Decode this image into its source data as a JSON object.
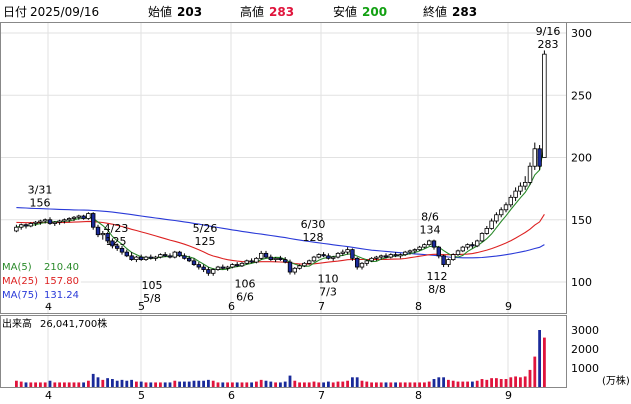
{
  "header": {
    "date_label": "日付",
    "date": "2025/09/16",
    "open_label": "始値",
    "open": "203",
    "high_label": "高値",
    "high": "283",
    "low_label": "安値",
    "low": "200",
    "close_label": "終値",
    "close": "283"
  },
  "legend": [
    {
      "name": "MA(5)",
      "value": "210.40",
      "color": "#2a8a2a"
    },
    {
      "name": "MA(25)",
      "value": "157.80",
      "color": "#d22"
    },
    {
      "name": "MA(75)",
      "value": "131.24",
      "color": "#2a3ad8"
    }
  ],
  "volume": {
    "title": "出来高",
    "total": "26,041,700株",
    "unit": "(万株)",
    "ticks": [
      "3000",
      "2000",
      "1000"
    ]
  },
  "chart_data": [
    {
      "type": "candlestick",
      "title": "",
      "y_ticks": [
        300,
        250,
        200,
        150,
        100
      ],
      "ylim": [
        90,
        310
      ],
      "x_ticks": [
        "4",
        "5",
        "6",
        "7",
        "8",
        "9"
      ],
      "annotations": [
        {
          "date": "3/31",
          "value": "156",
          "position": "above"
        },
        {
          "date": "4/23",
          "value": "125",
          "position": "above"
        },
        {
          "date": "5/26",
          "value": "125",
          "position": "above"
        },
        {
          "date": "6/30",
          "value": "128",
          "position": "above"
        },
        {
          "date": "8/6",
          "value": "134",
          "position": "above"
        },
        {
          "date": "9/16",
          "value": "283",
          "position": "above"
        },
        {
          "date": "5/8",
          "value": "105",
          "position": "below"
        },
        {
          "date": "6/6",
          "value": "106",
          "position": "below"
        },
        {
          "date": "7/3",
          "value": "110",
          "position": "below"
        },
        {
          "date": "8/8",
          "value": "112",
          "position": "below"
        }
      ],
      "candles_trend": [
        [
          3,
          141,
          146,
          140,
          144
        ],
        [
          4,
          144,
          147,
          142,
          146
        ],
        [
          5,
          146,
          147,
          143,
          145
        ],
        [
          6,
          145,
          148,
          144,
          147
        ],
        [
          7,
          147,
          149,
          145,
          148
        ],
        [
          8,
          148,
          150,
          146,
          149
        ],
        [
          9,
          149,
          151,
          147,
          150
        ],
        [
          10,
          150,
          152,
          146,
          147
        ],
        [
          11,
          147,
          149,
          145,
          148
        ],
        [
          12,
          148,
          150,
          146,
          149
        ],
        [
          13,
          149,
          151,
          147,
          150
        ],
        [
          14,
          150,
          152,
          148,
          151
        ],
        [
          15,
          151,
          153,
          149,
          152
        ],
        [
          16,
          152,
          154,
          150,
          153
        ],
        [
          17,
          153,
          154,
          150,
          151
        ],
        [
          18,
          151,
          156,
          150,
          155
        ],
        [
          19,
          155,
          156,
          142,
          144
        ],
        [
          20,
          144,
          146,
          136,
          138
        ],
        [
          21,
          138,
          141,
          134,
          139
        ],
        [
          22,
          139,
          140,
          131,
          133
        ],
        [
          23,
          133,
          135,
          127,
          129
        ],
        [
          24,
          129,
          131,
          125,
          127
        ],
        [
          25,
          127,
          129,
          122,
          124
        ],
        [
          26,
          124,
          126,
          120,
          121
        ],
        [
          27,
          121,
          124,
          117,
          118
        ],
        [
          28,
          118,
          121,
          116,
          120
        ],
        [
          29,
          120,
          122,
          117,
          118
        ],
        [
          30,
          118,
          121,
          117,
          120
        ],
        [
          31,
          120,
          122,
          118,
          119
        ],
        [
          32,
          119,
          121,
          117,
          120
        ],
        [
          33,
          120,
          123,
          119,
          122
        ],
        [
          34,
          122,
          124,
          120,
          121
        ],
        [
          35,
          121,
          123,
          119,
          120
        ],
        [
          36,
          120,
          125,
          119,
          124
        ],
        [
          37,
          124,
          125,
          120,
          121
        ],
        [
          38,
          121,
          123,
          118,
          119
        ],
        [
          39,
          119,
          121,
          116,
          117
        ],
        [
          40,
          117,
          119,
          113,
          114
        ],
        [
          41,
          114,
          116,
          110,
          112
        ],
        [
          42,
          112,
          114,
          108,
          110
        ],
        [
          43,
          110,
          112,
          105,
          107
        ],
        [
          44,
          107,
          111,
          105,
          110
        ],
        [
          45,
          110,
          113,
          109,
          112
        ],
        [
          46,
          112,
          114,
          110,
          111
        ],
        [
          47,
          111,
          113,
          109,
          112
        ],
        [
          48,
          112,
          115,
          111,
          114
        ],
        [
          49,
          114,
          116,
          112,
          113
        ],
        [
          50,
          113,
          116,
          112,
          115
        ],
        [
          51,
          115,
          118,
          114,
          117
        ],
        [
          52,
          117,
          119,
          115,
          116
        ],
        [
          53,
          116,
          120,
          115,
          119
        ],
        [
          54,
          119,
          125,
          118,
          123
        ],
        [
          55,
          123,
          125,
          119,
          120
        ],
        [
          56,
          120,
          122,
          117,
          118
        ],
        [
          57,
          118,
          120,
          116,
          119
        ],
        [
          58,
          119,
          121,
          117,
          118
        ],
        [
          59,
          118,
          120,
          115,
          116
        ],
        [
          60,
          116,
          118,
          106,
          108
        ],
        [
          61,
          108,
          112,
          106,
          111
        ],
        [
          62,
          111,
          114,
          110,
          113
        ],
        [
          63,
          113,
          116,
          112,
          115
        ],
        [
          64,
          115,
          118,
          114,
          117
        ],
        [
          65,
          117,
          121,
          116,
          120
        ],
        [
          66,
          120,
          123,
          119,
          122
        ],
        [
          67,
          122,
          124,
          120,
          121
        ],
        [
          68,
          121,
          123,
          118,
          119
        ],
        [
          69,
          119,
          121,
          117,
          120
        ],
        [
          70,
          120,
          124,
          119,
          123
        ],
        [
          71,
          123,
          126,
          121,
          124
        ],
        [
          72,
          124,
          128,
          122,
          126
        ],
        [
          73,
          126,
          127,
          117,
          119
        ],
        [
          74,
          119,
          120,
          110,
          112
        ],
        [
          75,
          112,
          116,
          110,
          115
        ],
        [
          76,
          115,
          118,
          113,
          117
        ],
        [
          77,
          117,
          120,
          116,
          119
        ],
        [
          78,
          119,
          121,
          117,
          120
        ],
        [
          79,
          120,
          122,
          118,
          121
        ],
        [
          80,
          121,
          123,
          119,
          120
        ],
        [
          81,
          120,
          123,
          119,
          122
        ],
        [
          82,
          122,
          124,
          120,
          121
        ],
        [
          83,
          121,
          123,
          119,
          122
        ],
        [
          84,
          122,
          125,
          121,
          124
        ],
        [
          85,
          124,
          126,
          122,
          125
        ],
        [
          86,
          125,
          127,
          123,
          126
        ],
        [
          87,
          126,
          129,
          125,
          128
        ],
        [
          88,
          128,
          131,
          127,
          130
        ],
        [
          89,
          130,
          134,
          129,
          133
        ],
        [
          90,
          133,
          134,
          126,
          128
        ],
        [
          91,
          128,
          129,
          119,
          121
        ],
        [
          92,
          121,
          122,
          112,
          114
        ],
        [
          93,
          114,
          119,
          112,
          118
        ],
        [
          94,
          118,
          123,
          117,
          122
        ],
        [
          95,
          122,
          126,
          121,
          125
        ],
        [
          96,
          125,
          129,
          124,
          128
        ],
        [
          97,
          128,
          131,
          126,
          130
        ],
        [
          98,
          130,
          132,
          127,
          129
        ],
        [
          99,
          129,
          134,
          128,
          133
        ],
        [
          100,
          133,
          140,
          132,
          139
        ],
        [
          101,
          139,
          145,
          138,
          143
        ],
        [
          102,
          143,
          151,
          142,
          149
        ],
        [
          103,
          149,
          156,
          147,
          154
        ],
        [
          104,
          154,
          160,
          152,
          158
        ],
        [
          105,
          158,
          164,
          156,
          162
        ],
        [
          106,
          162,
          170,
          160,
          168
        ],
        [
          107,
          168,
          176,
          165,
          173
        ],
        [
          108,
          173,
          180,
          170,
          177
        ],
        [
          109,
          177,
          185,
          174,
          180
        ],
        [
          110,
          180,
          196,
          178,
          193
        ],
        [
          111,
          193,
          212,
          190,
          207
        ],
        [
          112,
          207,
          210,
          190,
          193
        ],
        [
          113,
          200,
          286,
          200,
          283
        ]
      ]
    },
    {
      "type": "bar",
      "title": "出来高",
      "unit": "万株",
      "note": "daily volume; most days below 500, spikes at end",
      "peak_values": [
        3000,
        2600
      ]
    }
  ]
}
